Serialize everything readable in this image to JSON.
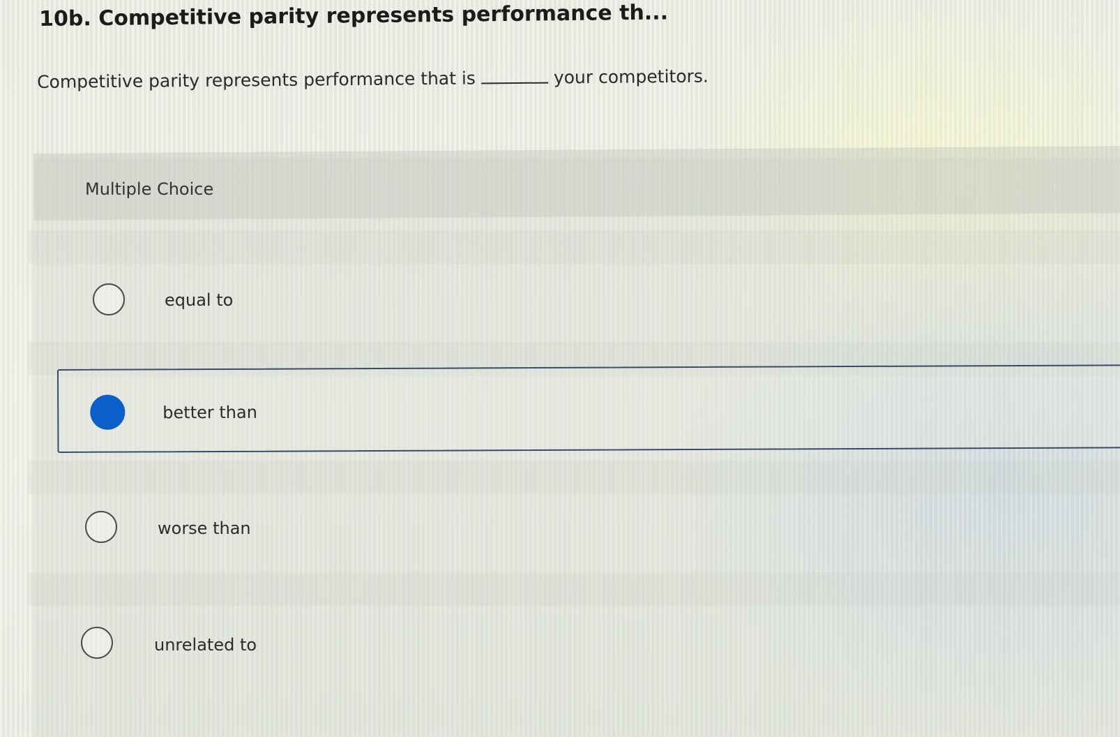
{
  "question": {
    "title": "10b. Competitive parity represents performance th...",
    "prompt_before": "Competitive parity represents performance that is",
    "prompt_after": "your competitors."
  },
  "answer_section": {
    "label": "Multiple Choice",
    "options": [
      {
        "label": "equal to",
        "selected": false
      },
      {
        "label": "better than",
        "selected": true
      },
      {
        "label": "worse than",
        "selected": false
      },
      {
        "label": "unrelated to",
        "selected": false
      }
    ]
  },
  "colors": {
    "selected_radio": "#0b5fc9",
    "selected_border": "#3a4a6a",
    "text": "#2b2b2b"
  }
}
